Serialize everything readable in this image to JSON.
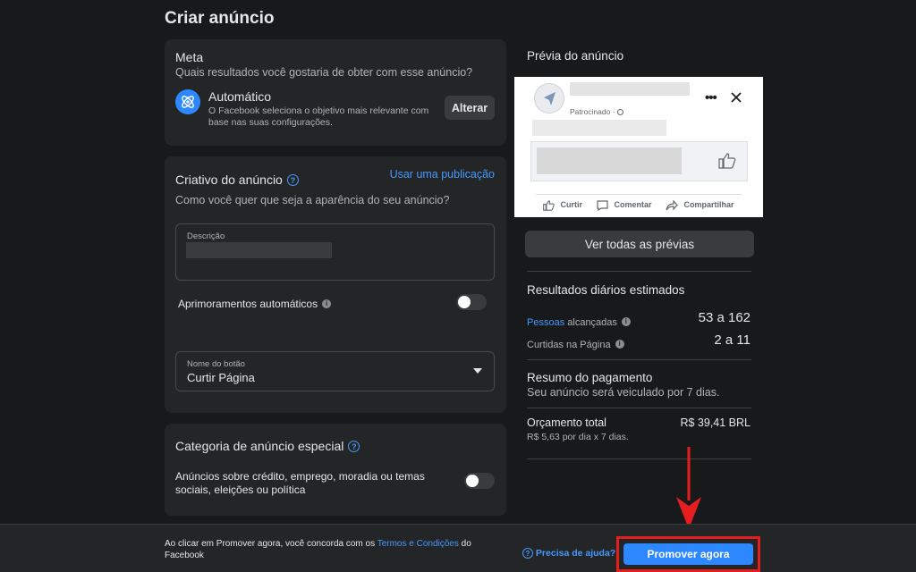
{
  "page": {
    "title": "Criar anúncio"
  },
  "meta": {
    "title": "Meta",
    "question": "Quais resultados você gostaria de obter com esse anúncio?",
    "option_title": "Automático",
    "option_desc_1": "O Facebook seleciona o objetivo mais relevante com",
    "option_desc_2": "base nas suas configurações.",
    "change_label": "Alterar",
    "icon": "atom-icon"
  },
  "creative": {
    "title": "Criativo do anúncio",
    "use_post_link": "Usar uma publicação",
    "question": "Como você quer que seja a aparência do seu anúncio?",
    "description_label": "Descrição",
    "auto_enhance_label": "Aprimoramentos automáticos",
    "button_name_label": "Nome do botão",
    "button_name_value": "Curtir Página"
  },
  "special_category": {
    "title": "Categoria de anúncio especial",
    "desc_1": "Anúncios sobre crédito, emprego, moradia ou temas",
    "desc_2": "sociais, eleições ou política"
  },
  "preview": {
    "title": "Prévia do anúncio",
    "sponsored": "Patrocinado · ",
    "actions": {
      "like": "Curtir",
      "comment": "Comentar",
      "share": "Compartilhar"
    },
    "see_all_label": "Ver todas as prévias"
  },
  "results": {
    "title": "Resultados diários estimados",
    "reach_link": "Pessoas",
    "reach_label": " alcançadas",
    "reach_value": "53 a 162",
    "likes_label": "Curtidas na Página",
    "likes_value": "2 a 11"
  },
  "payment": {
    "title": "Resumo do pagamento",
    "subtitle": "Seu anúncio será veiculado por 7 dias.",
    "budget_label": "Orçamento total",
    "budget_value": "R$ 39,41 BRL",
    "budget_detail": "R$ 5,63 por dia x 7 dias."
  },
  "footer": {
    "terms_prefix": "Ao clicar em Promover agora, você concorda com os ",
    "terms_link": "Termos e Condições",
    "terms_suffix_1": " do",
    "terms_suffix_2": "Facebook",
    "help_label": "Precisa de ajuda?",
    "promote_label": "Promover agora"
  },
  "colors": {
    "accent": "#2d88ff",
    "highlight": "#e41e1e",
    "background": "#18191a",
    "card": "#242526"
  }
}
